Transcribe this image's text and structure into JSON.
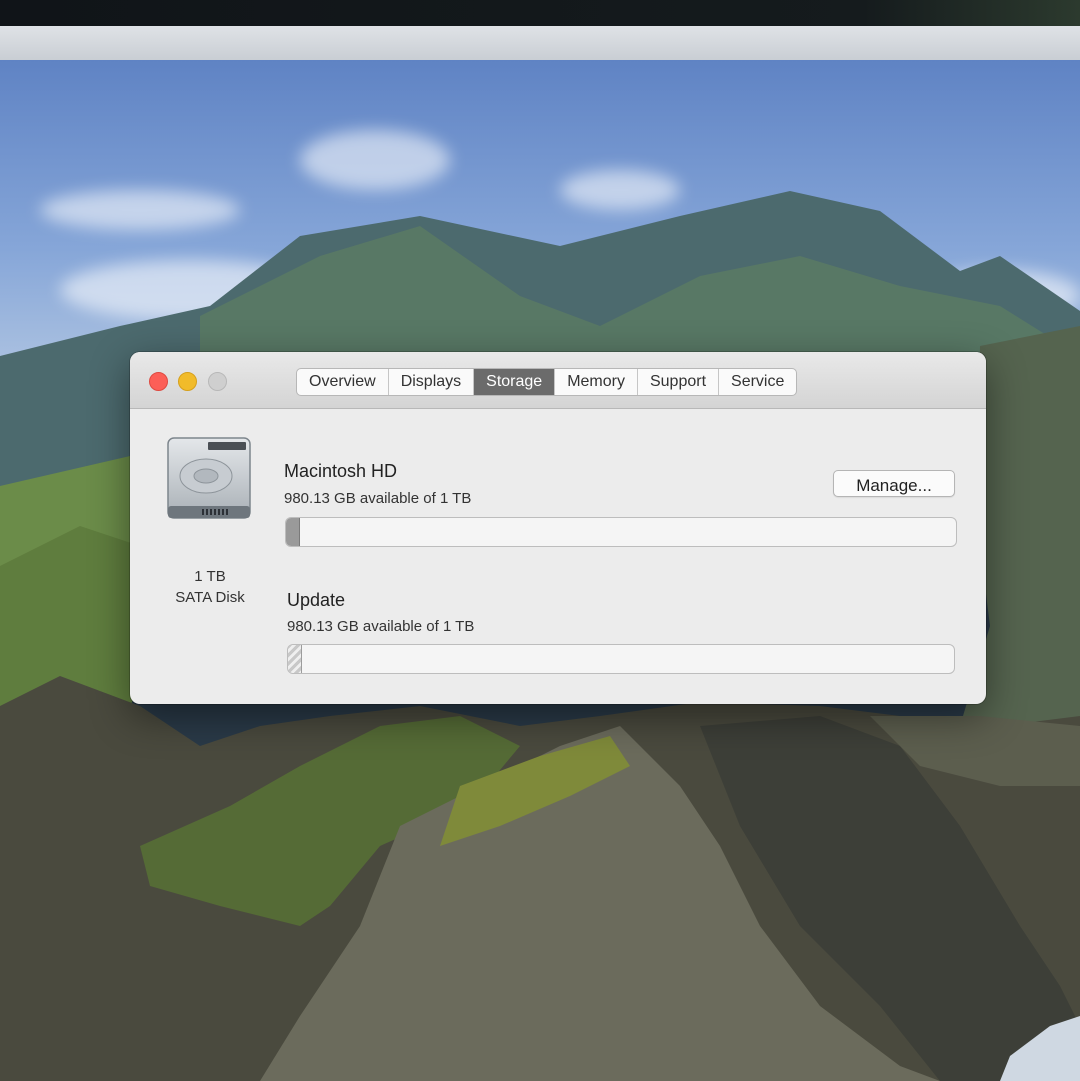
{
  "window": {
    "tabs": [
      {
        "label": "Overview"
      },
      {
        "label": "Displays"
      },
      {
        "label": "Storage"
      },
      {
        "label": "Memory"
      },
      {
        "label": "Support"
      },
      {
        "label": "Service"
      }
    ],
    "active_tab": "Storage"
  },
  "disk": {
    "capacity": "1 TB",
    "type": "SATA Disk"
  },
  "volumes": [
    {
      "name": "Macintosh HD",
      "availability": "980.13 GB available of 1 TB",
      "used_fraction": 0.02
    },
    {
      "name": "Update",
      "availability": "980.13 GB available of 1 TB",
      "used_fraction": 0.02
    }
  ],
  "buttons": {
    "manage_label": "Manage..."
  },
  "colors": {
    "close": "#fc5f57",
    "minimize": "#f1bb2a",
    "active_tab": "#6b6b6b"
  }
}
